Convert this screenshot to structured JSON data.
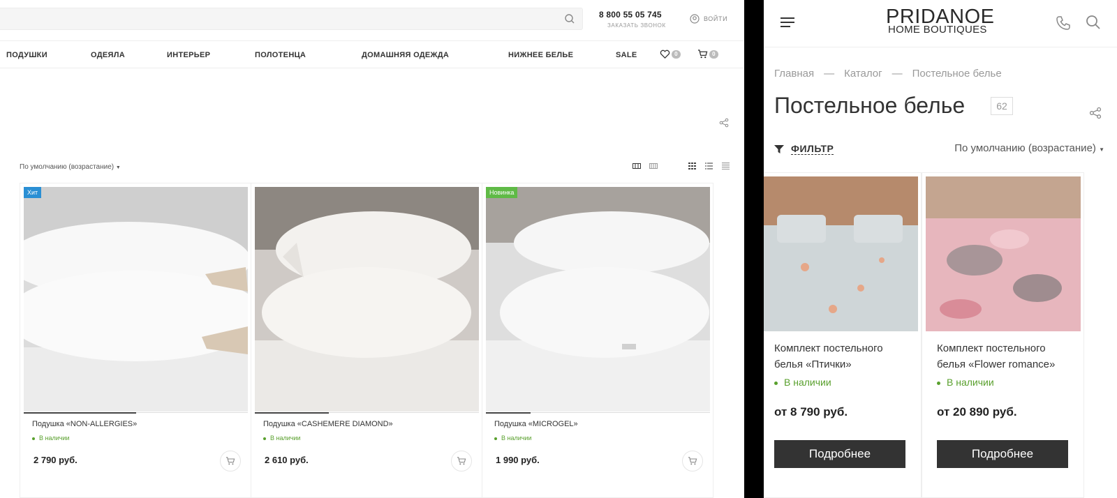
{
  "desktop": {
    "search": {
      "placeholder": ""
    },
    "phone": "8 800 55 05 745",
    "call_label": "ЗАКАЗАТЬ ЗВОНОК",
    "login_label": "ВОЙТИ",
    "nav": [
      "ПОДУШКИ",
      "ОДЕЯЛА",
      "ИНТЕРЬЕР",
      "ПОЛОТЕНЦА",
      "ДОМАШНЯЯ ОДЕЖДА",
      "НИЖНЕЕ БЕЛЬЕ",
      "SALE"
    ],
    "favorites_count": "0",
    "cart_count": "0",
    "sort_label": "По умолчанию (возрастание)",
    "products": [
      {
        "badge": "Хит",
        "badge_color": "#2a8fd4",
        "name": "Подушка «NON-ALLERGIES»",
        "availability": "В наличии",
        "price": "2 790 руб.",
        "slider_progress": 0.5
      },
      {
        "badge": "",
        "badge_color": "",
        "name": "Подушка «CASHEMERE DIAMOND»",
        "availability": "В наличии",
        "price": "2 610 руб.",
        "slider_progress": 0.33
      },
      {
        "badge": "Новинка",
        "badge_color": "#5fba46",
        "name": "Подушка «MICROGEL»",
        "availability": "В наличии",
        "price": "1 990 руб.",
        "slider_progress": 0.2
      }
    ]
  },
  "mobile": {
    "logo_line1": "PRIDANOE",
    "logo_line2": "HOME BOUTIQUES",
    "breadcrumb": [
      "Главная",
      "Каталог",
      "Постельное белье"
    ],
    "breadcrumb_sep": "—",
    "title": "Постельное белье",
    "count": "62",
    "filter_label": "ФИЛЬТР",
    "sort_label": "По умолчанию (возрастание)",
    "products": [
      {
        "name": "Комплект постельного белья «Птички»",
        "availability": "В наличии",
        "price": "от 8 790 руб.",
        "button": "Подробнее"
      },
      {
        "name": "Комплект постельного белья «Flower romance»",
        "availability": "В наличии",
        "price": "от 20 890 руб.",
        "button": "Подробнее"
      }
    ]
  },
  "colors": {
    "accent": "#333333",
    "in_stock": "#59a02d"
  }
}
